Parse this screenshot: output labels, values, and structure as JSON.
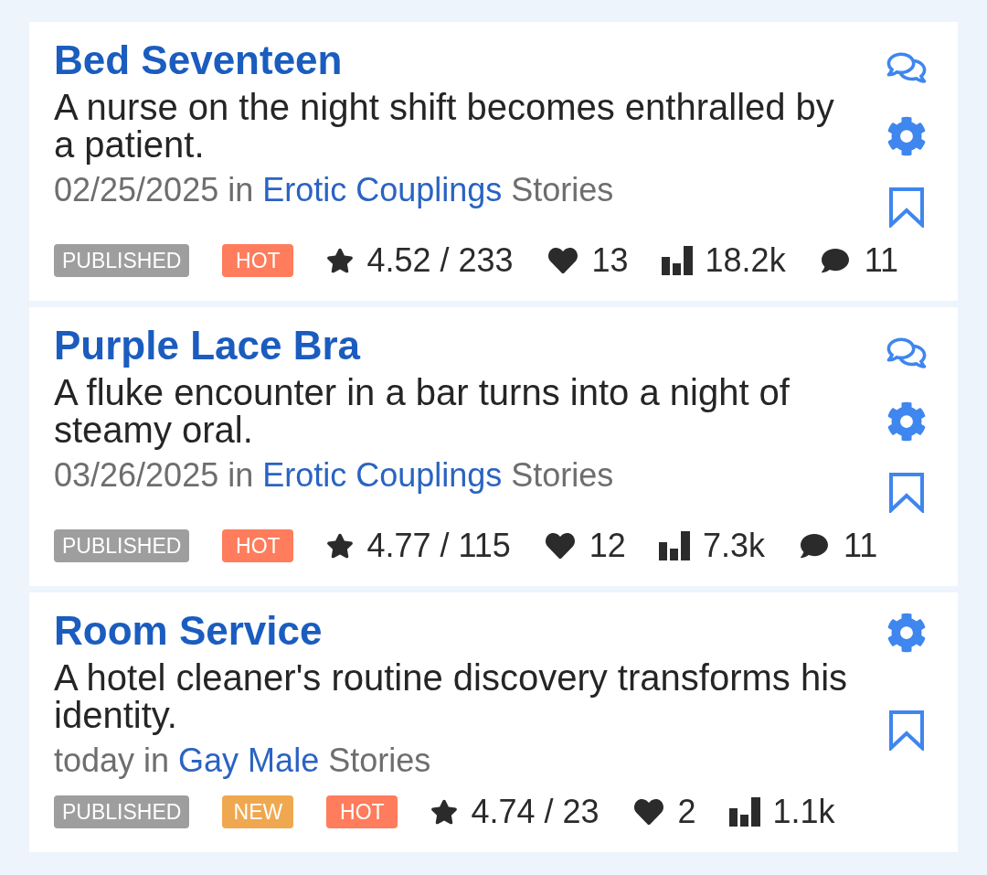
{
  "stories": [
    {
      "title": "Bed Seventeen",
      "description": "A nurse on the night shift becomes enthralled by a patient.",
      "date": "02/25/2025",
      "meta_in": "in",
      "category": "Erotic Couplings",
      "meta_suffix": "Stories",
      "discussion_link": true,
      "badges": [
        {
          "kind": "status",
          "label": "PUBLISHED"
        },
        {
          "kind": "hot",
          "label": "HOT"
        }
      ],
      "stats": [
        {
          "kind": "rating",
          "value": "4.52 / 233"
        },
        {
          "kind": "likes",
          "value": "13"
        },
        {
          "kind": "views",
          "value": "18.2k"
        },
        {
          "kind": "comments",
          "value": "11"
        }
      ]
    },
    {
      "title": "Purple Lace Bra",
      "description": "A fluke encounter in a bar turns into a night of steamy oral.",
      "date": "03/26/2025",
      "meta_in": "in",
      "category": "Erotic Couplings",
      "meta_suffix": "Stories",
      "discussion_link": true,
      "badges": [
        {
          "kind": "status",
          "label": "PUBLISHED"
        },
        {
          "kind": "hot",
          "label": "HOT"
        }
      ],
      "stats": [
        {
          "kind": "rating",
          "value": "4.77 / 115"
        },
        {
          "kind": "likes",
          "value": "12"
        },
        {
          "kind": "views",
          "value": "7.3k"
        },
        {
          "kind": "comments",
          "value": "11"
        }
      ]
    },
    {
      "title": "Room Service",
      "description": "A hotel cleaner's routine discovery transforms his identity.",
      "date": "today",
      "meta_in": "in",
      "category": "Gay Male",
      "meta_suffix": "Stories",
      "discussion_link": false,
      "badges": [
        {
          "kind": "status",
          "label": "PUBLISHED"
        },
        {
          "kind": "new",
          "label": "NEW"
        },
        {
          "kind": "hot",
          "label": "HOT"
        }
      ],
      "stats": [
        {
          "kind": "rating",
          "value": "4.74 / 23"
        },
        {
          "kind": "likes",
          "value": "2"
        },
        {
          "kind": "views",
          "value": "1.1k"
        }
      ]
    }
  ]
}
